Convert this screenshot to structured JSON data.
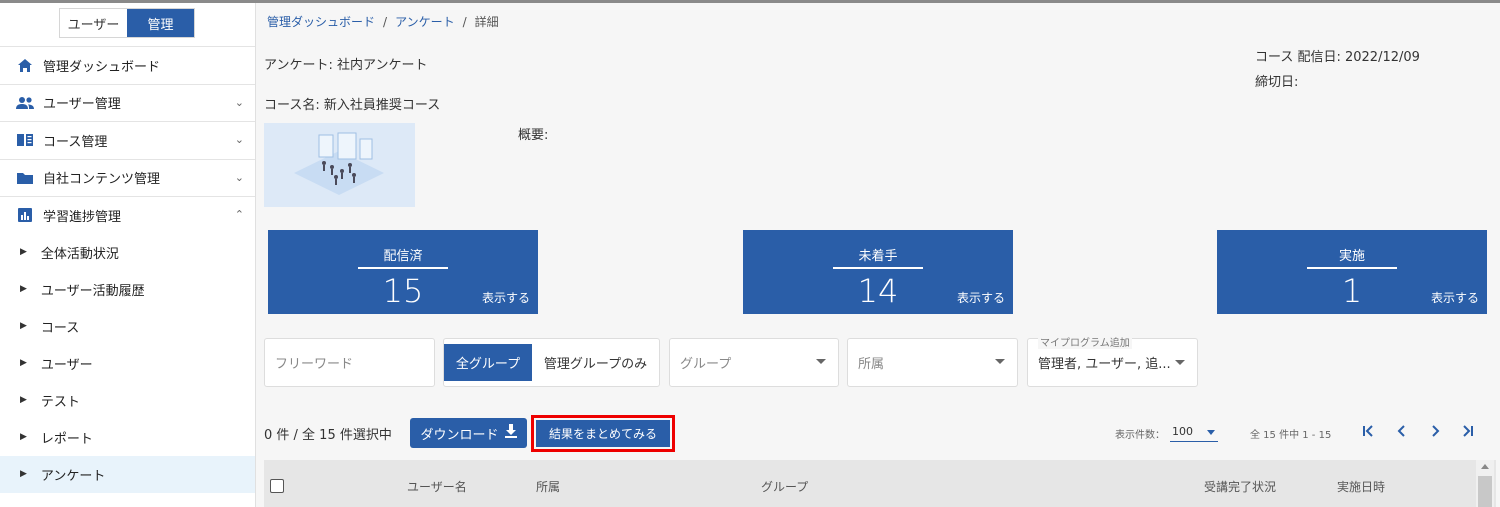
{
  "sidebar": {
    "toggle": {
      "user_label": "ユーザー",
      "admin_label": "管理"
    },
    "items": [
      {
        "label": "管理ダッシュボード",
        "icon": "home-icon"
      },
      {
        "label": "ユーザー管理",
        "icon": "people-icon"
      },
      {
        "label": "コース管理",
        "icon": "book-icon"
      },
      {
        "label": "自社コンテンツ管理",
        "icon": "folder-icon"
      },
      {
        "label": "学習進捗管理",
        "icon": "bar-chart-icon"
      }
    ],
    "sub_items": [
      {
        "label": "全体活動状況"
      },
      {
        "label": "ユーザー活動履歴"
      },
      {
        "label": "コース"
      },
      {
        "label": "ユーザー"
      },
      {
        "label": "テスト"
      },
      {
        "label": "レポート"
      },
      {
        "label": "アンケート"
      }
    ]
  },
  "breadcrumb": {
    "item1": "管理ダッシュボード",
    "item2": "アンケート",
    "item3": "詳細",
    "sep": "/"
  },
  "info": {
    "survey": "アンケート: 社内アンケート",
    "course": "コース名: 新入社員推奨コース",
    "overview": "概要:",
    "delivery": "コース 配信日: 2022/12/09",
    "deadline": "締切日:"
  },
  "cards": [
    {
      "title": "配信済",
      "value": "15",
      "link": "表示する"
    },
    {
      "title": "未着手",
      "value": "14",
      "link": "表示する"
    },
    {
      "title": "実施",
      "value": "1",
      "link": "表示する"
    }
  ],
  "filters": {
    "freeword_placeholder": "フリーワード",
    "all_groups": "全グループ",
    "managed_only": "管理グループのみ",
    "group": "グループ",
    "affiliation": "所属",
    "my_program_label": "マイプログラム追加",
    "my_program_value": "管理者, ユーザー, 追..."
  },
  "toolbar": {
    "selection": "0 件 / 全 15 件選択中",
    "download": "ダウンロード",
    "summarize": "結果をまとめてみる",
    "per_page_label": "表示件数：",
    "per_page_value": "100",
    "range": "全 15 件中 1 - 15"
  },
  "table": {
    "columns": [
      "ユーザー名",
      "所属",
      "グループ",
      "受講完了状況",
      "実施日時"
    ]
  },
  "colors": {
    "accent": "#2a5ea8",
    "highlight": "#e00000"
  }
}
